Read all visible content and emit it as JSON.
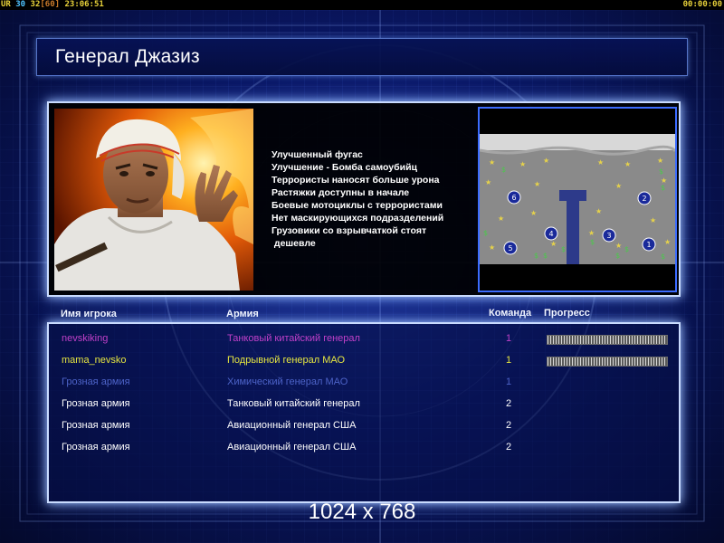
{
  "status_bar": {
    "ur_label": "UR",
    "value_1": "30",
    "value_2": "32",
    "value_3": "[60]",
    "clock": "23:06:51",
    "timer": "00:00:00"
  },
  "title": "Генерал Джазиз",
  "general_bonuses": [
    "Улучшенный фугас",
    "Улучшение - Бомба самоубийц",
    "Террористы наносят больше урона",
    "Растяжки доступны в начале",
    "Боевые мотоциклы с террористами",
    "Нет маскирующихся подразделений",
    "Грузовики со взрывчаткой стоят",
    " дешевле"
  ],
  "minimap": {
    "start_positions": [
      "1",
      "2",
      "3",
      "4",
      "5",
      "6"
    ]
  },
  "columns": {
    "player": "Имя игрока",
    "army": "Армия",
    "team": "Команда",
    "progress": "Прогресс"
  },
  "players": [
    {
      "name": "nevskiking",
      "army": "Танковый китайский генерал",
      "team": "1",
      "progress": 1.0,
      "color": "#c040c8"
    },
    {
      "name": "mama_nevsko",
      "army": "Подрывной генерал МАО",
      "team": "1",
      "progress": 1.0,
      "color": "#e6e640"
    },
    {
      "name": "Грозная армия",
      "army": "Химический генерал МАО",
      "team": "1",
      "progress": null,
      "color": "#4d63c8"
    },
    {
      "name": "Грозная армия",
      "army": "Танковый китайский генерал",
      "team": "2",
      "progress": null,
      "color": "#ffffff"
    },
    {
      "name": "Грозная армия",
      "army": "Авиационный генерал США",
      "team": "2",
      "progress": null,
      "color": "#ffffff"
    },
    {
      "name": "Грозная армия",
      "army": "Авиационный генерал США",
      "team": "2",
      "progress": null,
      "color": "#ffffff"
    }
  ],
  "resolution": "1024 x 768",
  "colors": {
    "panel_border": "#c9dbff",
    "background": "#0a1660"
  }
}
